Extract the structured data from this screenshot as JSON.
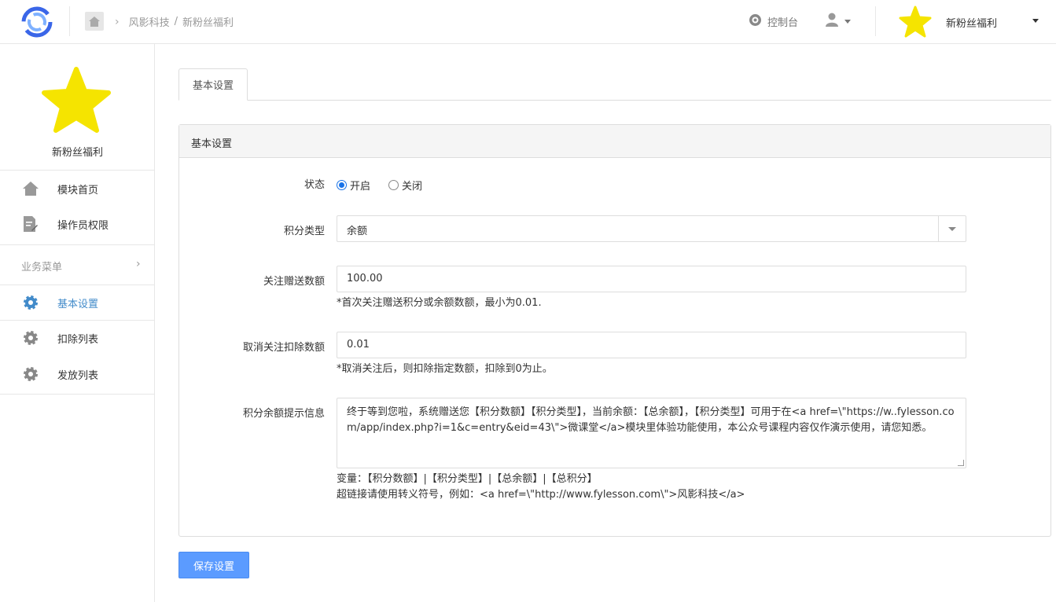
{
  "header": {
    "breadcrumb_company": "风影科技",
    "breadcrumb_separator": "/",
    "breadcrumb_current": "新粉丝福利",
    "console_label": "控制台",
    "account_name": "新粉丝福利",
    "icons": [
      "logo-icon",
      "home-icon",
      "chevron-right-icon",
      "dashboard-icon",
      "user-icon",
      "star-icon"
    ]
  },
  "sidebar": {
    "module_name": "新粉丝福利",
    "items": [
      {
        "label": "模块首页",
        "icon": "home-icon"
      },
      {
        "label": "操作员权限",
        "icon": "document-edit-icon"
      }
    ],
    "section_label": "业务菜单",
    "business_items": [
      {
        "label": "基本设置",
        "icon": "gear-icon",
        "active": true
      },
      {
        "label": "扣除列表",
        "icon": "gear-icon"
      },
      {
        "label": "发放列表",
        "icon": "gear-icon"
      }
    ]
  },
  "tabs": [
    "基本设置"
  ],
  "panel": {
    "title": "基本设置",
    "status_label": "状态",
    "status_on": "开启",
    "status_off": "关闭",
    "status_selected": "开启",
    "type_label": "积分类型",
    "type_value": "余额",
    "follow_label": "关注赠送数额",
    "follow_value": "100.00",
    "follow_help": "*首次关注赠送积分或余额数额，最小为0.01.",
    "unfollow_label": "取消关注扣除数额",
    "unfollow_value": "0.01",
    "unfollow_help": "*取消关注后，则扣除指定数额，扣除到0为止。",
    "message_label": "积分余额提示信息",
    "message_value": "终于等到您啦，系统赠送您【积分数额】【积分类型】，当前余额：【总余额】，【积分类型】可用于在<a href=\\\"https://w..fylesson.com/app/index.php?i=1&c=entry&eid=43\\\">微课堂</a>模块里体验功能使用，本公众号课程内容仅作演示使用，请您知悉。",
    "message_vars": "变量：【积分数额】|【积分类型】|【总余额】|【总积分】",
    "message_link_help": "超链接请使用转义符号，例如：<a href=\\\"http://www.fylesson.com\\\">风影科技</a>"
  },
  "save_button": "保存设置",
  "colors": {
    "accent": "#428bca",
    "button": "#5b9bff",
    "star": "#f5e400"
  }
}
